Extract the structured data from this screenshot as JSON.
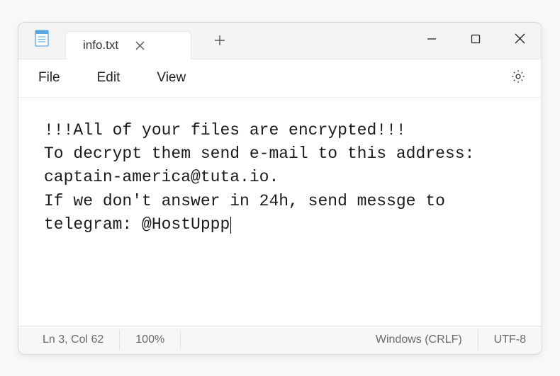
{
  "titlebar": {
    "tab_title": "info.txt",
    "new_tab_label": "+"
  },
  "menubar": {
    "file": "File",
    "edit": "Edit",
    "view": "View"
  },
  "content": {
    "text": "!!!All of your files are encrypted!!!\nTo decrypt them send e-mail to this address: captain-america@tuta.io.\nIf we don't answer in 24h, send messge to telegram: @HostUppp"
  },
  "statusbar": {
    "position": "Ln 3, Col 62",
    "zoom": "100%",
    "line_endings": "Windows (CRLF)",
    "encoding": "UTF-8"
  },
  "icons": {
    "notepad": "notepad-icon",
    "tab_close": "close-icon",
    "minimize": "minimize-icon",
    "maximize": "maximize-icon",
    "window_close": "close-icon",
    "settings": "gear-icon"
  }
}
